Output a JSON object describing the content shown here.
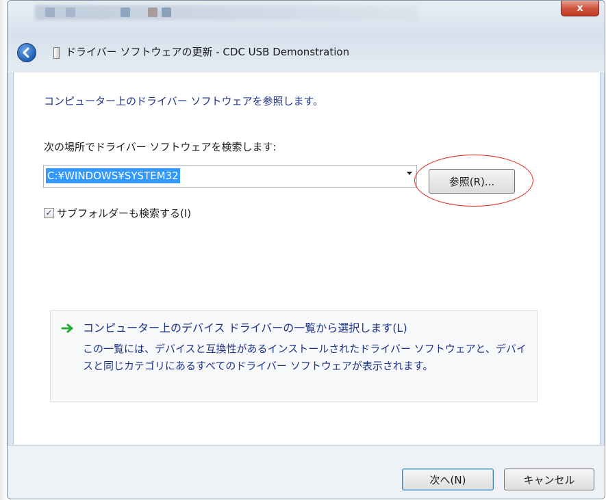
{
  "window": {
    "title": "ドライバー ソフトウェアの更新 - CDC USB Demonstration",
    "close_label": "x"
  },
  "content": {
    "instruction": "コンピューター上のドライバー ソフトウェアを参照します。",
    "search_label": "次の場所でドライバー ソフトウェアを検索します:",
    "path_value": "C:¥WINDOWS¥SYSTEM32",
    "browse_label": "参照(R)...",
    "subfolder_label": "サブフォルダーも検索する(I)",
    "subfolder_checked": true,
    "pick_title": "コンピューター上のデバイス ドライバーの一覧から選択します(L)",
    "pick_desc": "この一覧には、デバイスと互換性があるインストールされたドライバー ソフトウェアと、デバイスと同じカテゴリにあるすべてのドライバー ソフトウェアが表示されます。"
  },
  "footer": {
    "next_label": "次へ(N)",
    "cancel_label": "キャンセル"
  },
  "colors": {
    "link_blue": "#1e3287",
    "selection": "#3399ff",
    "highlight_ellipse": "#e0201a",
    "arrow_green": "#2aa836"
  },
  "icons": [
    "back-arrow-icon",
    "usb-device-icon",
    "green-arrow-icon",
    "chevron-down-icon",
    "close-icon"
  ]
}
